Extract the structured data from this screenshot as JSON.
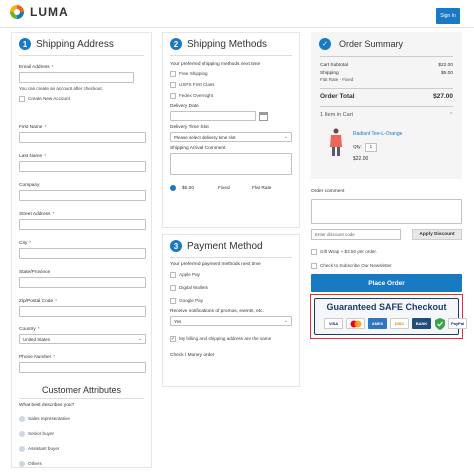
{
  "header": {
    "brand": "LUMA",
    "signin_label": "Sign In"
  },
  "shipping_address": {
    "step": "1",
    "title": "Shipping Address",
    "email_label": "Email Address",
    "email_note": "You can create an account after checkout.",
    "create_account_label": "Create New Account",
    "first_name_label": "First Name",
    "last_name_label": "Last Name",
    "company_label": "Company",
    "street_label": "Street Address",
    "city_label": "City",
    "state_label": "State/Province",
    "zip_label": "Zip/Postal Code",
    "country_label": "Country",
    "country_value": "United States",
    "phone_label": "Phone Number",
    "required_mark": "*"
  },
  "customer_attributes": {
    "title": "Customer Attributes",
    "question": "What best describes you?",
    "options": [
      "Sales representative",
      "Senior buyer",
      "Assistant buyer",
      "Others"
    ]
  },
  "shipping_methods": {
    "step": "2",
    "title": "Shipping Methods",
    "preferred_label": "Your preferred shipping methods next time",
    "options": [
      "Free Shipping",
      "USPS First Class",
      "Fedex Overnight"
    ],
    "delivery_date_label": "Delivery Date",
    "delivery_slot_label": "Delivery Time Slot",
    "delivery_slot_value": "Please select delivery time slot",
    "arrival_comment_label": "Shipping Arrival Comment",
    "rate_price": "$5.00",
    "rate_type": "Fixed",
    "rate_name": "Flat Rate"
  },
  "payment_method": {
    "step": "3",
    "title": "Payment Method",
    "preferred_label": "Your preferred payment methods next time",
    "options": [
      "Apple Pay",
      "Digital Wallets",
      "Google Pay"
    ],
    "promo_label": "Receive notifications of promos, events, etc.",
    "promo_value": "Yes",
    "billing_same_label": "My billing and shipping address are the same",
    "method_label": "Check / Money order"
  },
  "order_summary": {
    "title": "Order Summary",
    "subtotal_label": "Cart Subtotal",
    "subtotal_value": "$22.00",
    "shipping_label": "Shipping",
    "shipping_value": "$5.00",
    "shipping_sub": "Flat Rate - Fixed",
    "total_label": "Order Total",
    "total_value": "$27.00",
    "items_label": "1 Item in Cart",
    "product_name": "Radiant Tee-L-Orange",
    "qty_label": "Qty:",
    "qty_value": "1",
    "product_price": "$22.00"
  },
  "order_extras": {
    "comment_label": "Order comment",
    "discount_placeholder": "Enter discount code",
    "apply_label": "Apply Discount",
    "gift_wrap_label": "Gift Wrap + $3.50 per order.",
    "newsletter_label": "Check to Subscribe Our Newsletter",
    "place_order_label": "Place Order"
  },
  "safe_checkout": {
    "title": "Guaranteed SAFE Checkout",
    "cards": [
      "VISA",
      "MC",
      "AMEX",
      "DISC",
      "BANK",
      "",
      "PayPal"
    ]
  },
  "colors": {
    "accent": "#1979c3",
    "required": "#e02b27",
    "badge_border": "#e0322a"
  }
}
